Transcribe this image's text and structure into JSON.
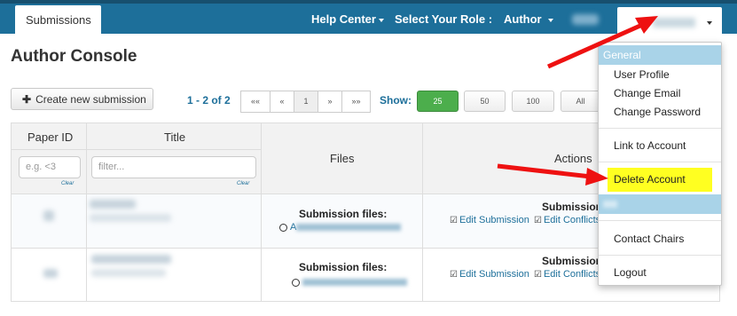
{
  "nav": {
    "tab_submissions": "Submissions",
    "help_center": "Help Center",
    "select_role": "Select Your Role :",
    "role": "Author"
  },
  "page": {
    "title": "Author Console"
  },
  "toolbar": {
    "create_label": "Create new submission",
    "pager_text": "1 - 2 of 2",
    "pager_buttons": [
      "««",
      "«",
      "1",
      "»",
      "»»"
    ],
    "show_label": "Show:",
    "page_sizes": [
      "25",
      "50",
      "100",
      "All"
    ],
    "active_size": "25"
  },
  "table": {
    "headers": {
      "paper_id": "Paper ID",
      "title": "Title",
      "files": "Files",
      "actions": "Actions"
    },
    "filters": {
      "paper_id_placeholder": "e.g. <3",
      "title_placeholder": "filter...",
      "clear": "Clear"
    },
    "rows": [
      {
        "files_label": "Submission files:",
        "file_prefix": "A",
        "action_head": "Submission",
        "edit_submission": "Edit Submission",
        "edit_conflicts": "Edit Conflicts"
      },
      {
        "files_label": "Submission files:",
        "file_prefix": "",
        "action_head": "Submission",
        "edit_submission": "Edit Submission",
        "edit_conflicts": "Edit Conflicts"
      }
    ]
  },
  "user_menu": {
    "section_general": "General",
    "items": [
      "User Profile",
      "Change Email",
      "Change Password",
      "Link to Account",
      "Delete Account",
      "Contact Chairs",
      "Logout"
    ],
    "highlighted": "Delete Account"
  },
  "colors": {
    "topbar": "#1d6f9a",
    "link": "#1d6f9a",
    "active_green": "#4cae4c",
    "highlight": "#ffff21",
    "arrow": "#ee1111"
  }
}
